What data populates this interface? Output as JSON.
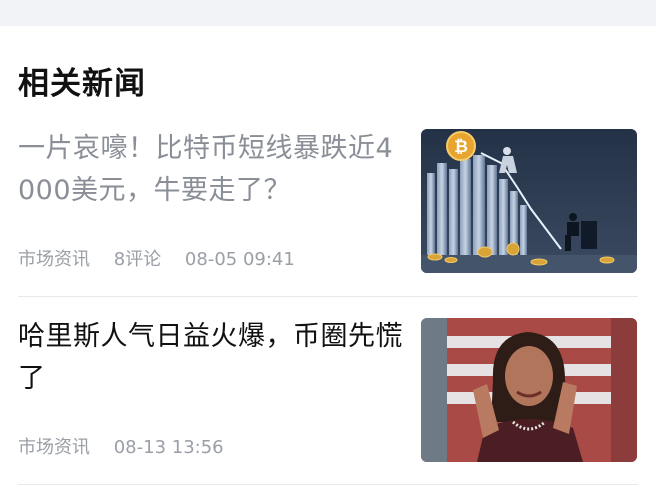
{
  "section": {
    "title": "相关新闻"
  },
  "news": [
    {
      "headline": "一片哀嚎！比特币短线暴跌近4000美元，牛要走了？",
      "source": "市场资讯",
      "comments": "8评论",
      "time": "08-05 09:41",
      "read": true,
      "thumbnail": "bitcoin-crash-illustration"
    },
    {
      "headline": "哈里斯人气日益火爆，币圈先慌了",
      "source": "市场资讯",
      "time": "08-13 13:56",
      "read": false,
      "thumbnail": "clapping-woman-photo"
    }
  ],
  "colors": {
    "title": "#111111",
    "read_headline": "#8a8e97",
    "meta": "#9a9ea6",
    "divider": "#e8e9ee",
    "top_band": "#f2f3f7"
  }
}
